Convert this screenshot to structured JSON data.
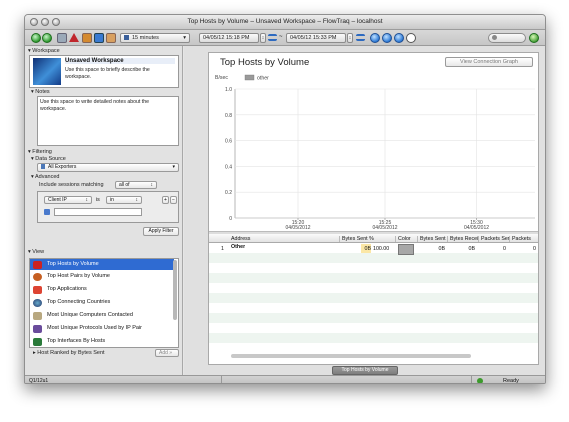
{
  "window": {
    "title": "Top Hosts by Volume – Unsaved Workspace – FlowTraq – localhost"
  },
  "toolbar": {
    "time_window": "15 minutes",
    "start_time": "04/05/12 15:18 PM",
    "range_sep": "~",
    "end_time": "04/05/12 15:33 PM"
  },
  "sidebar": {
    "workspace_section": "Workspace",
    "workspace_name": "Unsaved Workspace",
    "workspace_desc": "Use this space to briefly describe the workspace.",
    "notes_section": "Notes",
    "notes_text": "Use this space to write detailed notes about the workspace.",
    "filtering_section": "Filtering",
    "data_source_section": "Data Source",
    "data_source_value": "All Exporters",
    "advanced_section": "Advanced",
    "include_label": "Include sessions matching",
    "include_value": "all of",
    "filter_field": "Client IP",
    "filter_is": "is",
    "filter_op": "in",
    "apply_filter": "Apply Filter",
    "view_section": "View",
    "views": [
      {
        "label": "Top Hosts by Volume"
      },
      {
        "label": "Top Host Pairs by Volume"
      },
      {
        "label": "Top Applications"
      },
      {
        "label": "Top Connecting Countries"
      },
      {
        "label": "Most Unique Computers Contacted"
      },
      {
        "label": "Most Unique Protocols Used by IP Pair"
      },
      {
        "label": "Top Interfaces By Hosts"
      }
    ],
    "ranked_label": "Host Ranked by Bytes Sent",
    "add_label": "Add »"
  },
  "main": {
    "panel_title": "Top Hosts by Volume",
    "view_graph_button": "View Connection Graph",
    "tab_label": "Top Hosts by Volume"
  },
  "chart_data": {
    "type": "line",
    "ylabel": "B/sec",
    "legend": [
      "other"
    ],
    "yticks": [
      "1.0",
      "0.8",
      "0.6",
      "0.4",
      "0.2",
      "0"
    ],
    "ylim": [
      0,
      1.0
    ],
    "xticks": [
      {
        "time": "15:20",
        "date": "04/05/2012"
      },
      {
        "time": "15:25",
        "date": "04/05/2012"
      },
      {
        "time": "15:30",
        "date": "04/05/2012"
      }
    ],
    "series": [
      {
        "name": "other",
        "values": []
      }
    ],
    "grid": true
  },
  "table": {
    "columns": [
      "Address",
      "Bytes Sent %",
      "Color",
      "Bytes Sent",
      "Bytes Received",
      "Packets Sent",
      "Packets"
    ],
    "rows": [
      {
        "index": "1",
        "address": "Other",
        "pct_value": "0B",
        "pct": "100.00",
        "bytes_sent": "0B",
        "bytes_recv": "0B",
        "pkts_sent": "0",
        "pkts": "0"
      }
    ]
  },
  "status": {
    "page": "Q1/12u1",
    "ready": "Ready"
  },
  "colors": {
    "accent": "#2f6bd2",
    "highlight": "#fbe7a6",
    "ready_led": "#3c9a2c"
  }
}
